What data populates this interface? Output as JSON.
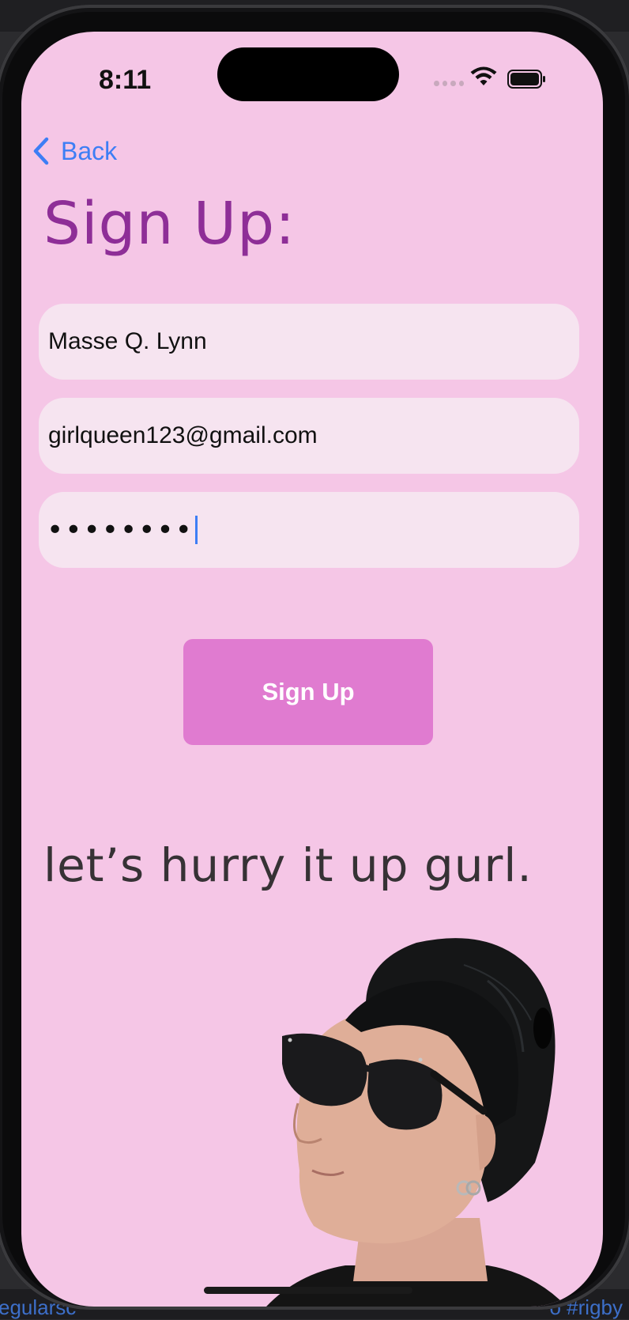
{
  "status_bar": {
    "time": "8:11"
  },
  "nav": {
    "back_label": "Back"
  },
  "form": {
    "title": "Sign Up:",
    "name_value": "Masse Q. Lynn",
    "email_value": "girlqueen123@gmail.com",
    "password_masked": "••••••••",
    "submit_label": "Sign Up"
  },
  "tagline": "let’s hurry it up gurl.",
  "desktop_bg": {
    "left_text": "egularsc",
    "right_text": "o #rigby"
  },
  "colors": {
    "screen_bg": "#f5c6e6",
    "title": "#8e2e97",
    "accent_link": "#3d7ef5",
    "button_bg": "#e07bd0",
    "field_bg": "#f6e4f0"
  },
  "icons": {
    "back": "chevron-left-icon",
    "wifi": "wifi-icon",
    "battery": "battery-icon",
    "signal": "cellular-signal-icon"
  }
}
